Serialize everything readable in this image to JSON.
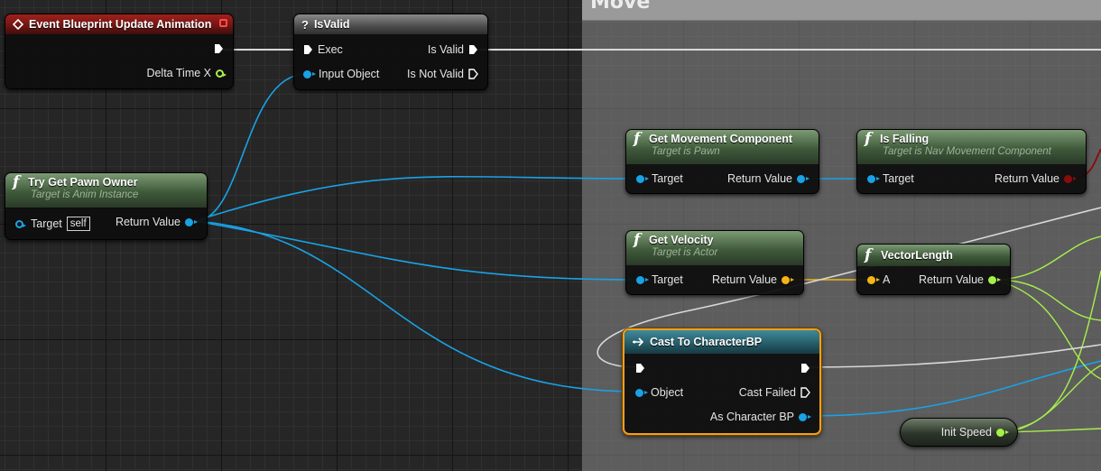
{
  "graph": {
    "comment_title": "Move",
    "nodes": {
      "event": {
        "title": "Event Blueprint Update Animation",
        "out_pin": "Delta Time X"
      },
      "isvalid": {
        "title": "IsValid",
        "exec_in": "Exec",
        "input": "Input Object",
        "valid": "Is Valid",
        "not_valid": "Is Not Valid"
      },
      "pawn_owner": {
        "title": "Try Get Pawn Owner",
        "subtitle": "Target is Anim Instance",
        "target": "Target",
        "self_label": "self",
        "return": "Return Value"
      },
      "movement": {
        "title": "Get Movement Component",
        "subtitle": "Target is Pawn",
        "target": "Target",
        "return": "Return Value"
      },
      "falling": {
        "title": "Is Falling",
        "subtitle": "Target is Nav Movement Component",
        "target": "Target",
        "return": "Return Value"
      },
      "velocity": {
        "title": "Get Velocity",
        "subtitle": "Target is Actor",
        "target": "Target",
        "return": "Return Value"
      },
      "vlength": {
        "title": "VectorLength",
        "input": "A",
        "return": "Return Value"
      },
      "cast": {
        "title": "Cast To CharacterBP",
        "object": "Object",
        "failed": "Cast Failed",
        "as_char": "As Character BP"
      },
      "init_speed": {
        "label": "Init Speed"
      }
    },
    "pin_colors": {
      "object": "#19a2e6",
      "float": "#a6f04a",
      "vector": "#f5b512",
      "bool": "#8b0b0b",
      "exec": "#ffffff"
    }
  }
}
